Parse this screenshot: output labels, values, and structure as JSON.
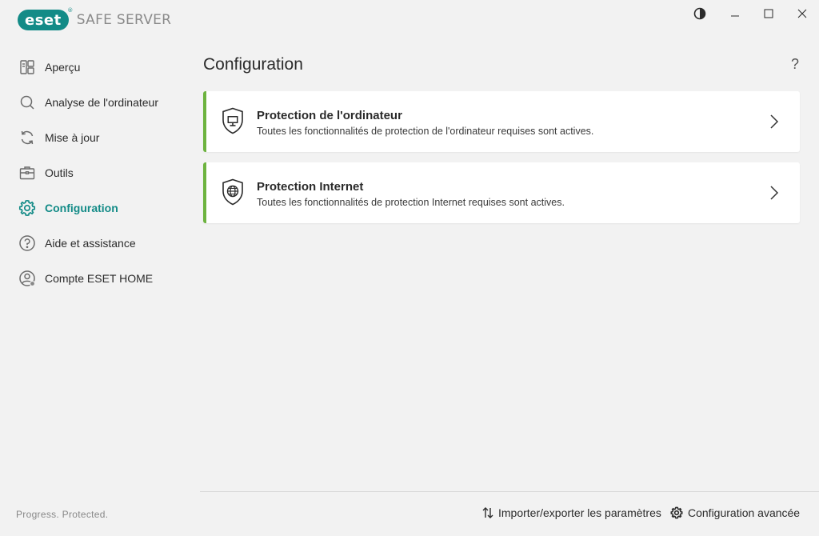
{
  "app": {
    "logo_text": "eset",
    "logo_reg": "®",
    "product": "SAFE SERVER",
    "tagline": "Progress. Protected."
  },
  "window_controls": [
    {
      "name": "contrast-toggle-button",
      "icon": "contrast-icon"
    },
    {
      "name": "minimize-button",
      "icon": "minimize-icon"
    },
    {
      "name": "maximize-button",
      "icon": "maximize-icon"
    },
    {
      "name": "close-button",
      "icon": "close-icon"
    }
  ],
  "sidebar": {
    "items": [
      {
        "label": "Aperçu",
        "icon": "dashboard-icon"
      },
      {
        "label": "Analyse de l'ordinateur",
        "icon": "search-icon"
      },
      {
        "label": "Mise à jour",
        "icon": "refresh-icon"
      },
      {
        "label": "Outils",
        "icon": "briefcase-icon"
      },
      {
        "label": "Configuration",
        "icon": "gear-icon",
        "active": true
      },
      {
        "label": "Aide et assistance",
        "icon": "help-circle-icon"
      },
      {
        "label": "Compte ESET HOME",
        "icon": "user-account-icon"
      }
    ]
  },
  "main": {
    "title": "Configuration",
    "help": "?",
    "cards": [
      {
        "title": "Protection de l'ordinateur",
        "description": "Toutes les fonctionnalités de protection de l'ordinateur requises sont actives.",
        "icon": "shield-monitor-icon"
      },
      {
        "title": "Protection Internet",
        "description": "Toutes les fonctionnalités de protection Internet requises sont actives.",
        "icon": "shield-globe-icon"
      }
    ]
  },
  "footer": {
    "import_export": "Importer/exporter les paramètres",
    "advanced": "Configuration avancée"
  },
  "colors": {
    "accent": "#138b87",
    "status_ok": "#6db33f",
    "background": "#f2f2f2"
  }
}
